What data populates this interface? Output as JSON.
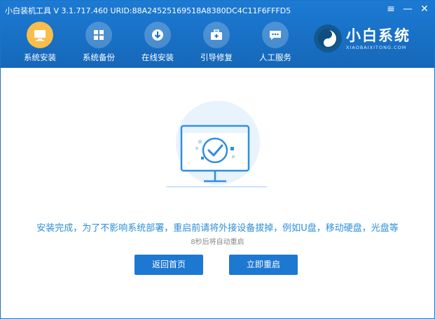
{
  "titlebar": {
    "title": "小白装机工具 V 3.1.717.460 URID:88A24525169518A8380DC4C11F6FFFD5"
  },
  "window_controls": [
    {
      "icon": "menu-icon",
      "glyph": "≡"
    },
    {
      "icon": "minimize-icon",
      "glyph": "—"
    },
    {
      "icon": "close-icon",
      "glyph": "✕"
    }
  ],
  "nav": {
    "items": [
      {
        "label": "系统安装",
        "icon": "system-install-icon",
        "active": true
      },
      {
        "label": "系统备份",
        "icon": "system-backup-icon",
        "active": false
      },
      {
        "label": "在线安装",
        "icon": "online-install-icon",
        "active": false
      },
      {
        "label": "引导修复",
        "icon": "boot-repair-icon",
        "active": false
      },
      {
        "label": "人工服务",
        "icon": "customer-service-icon",
        "active": false
      }
    ]
  },
  "logo": {
    "title": "小白系统",
    "subtitle": "XIAOBAIXITONG.COM"
  },
  "main": {
    "message": "安装完成，为了不影响系统部署，重启前请将外接设备拔掉，例如U盘，移动硬盘，光盘等",
    "countdown": "8秒后将自动重启",
    "home_button": "返回首页",
    "restart_button": "立即重启"
  },
  "colors": {
    "header": "#1a70c6",
    "accent": "#2a8ed8",
    "button": "#1d78d2",
    "active_nav": "#f8bd4a"
  }
}
